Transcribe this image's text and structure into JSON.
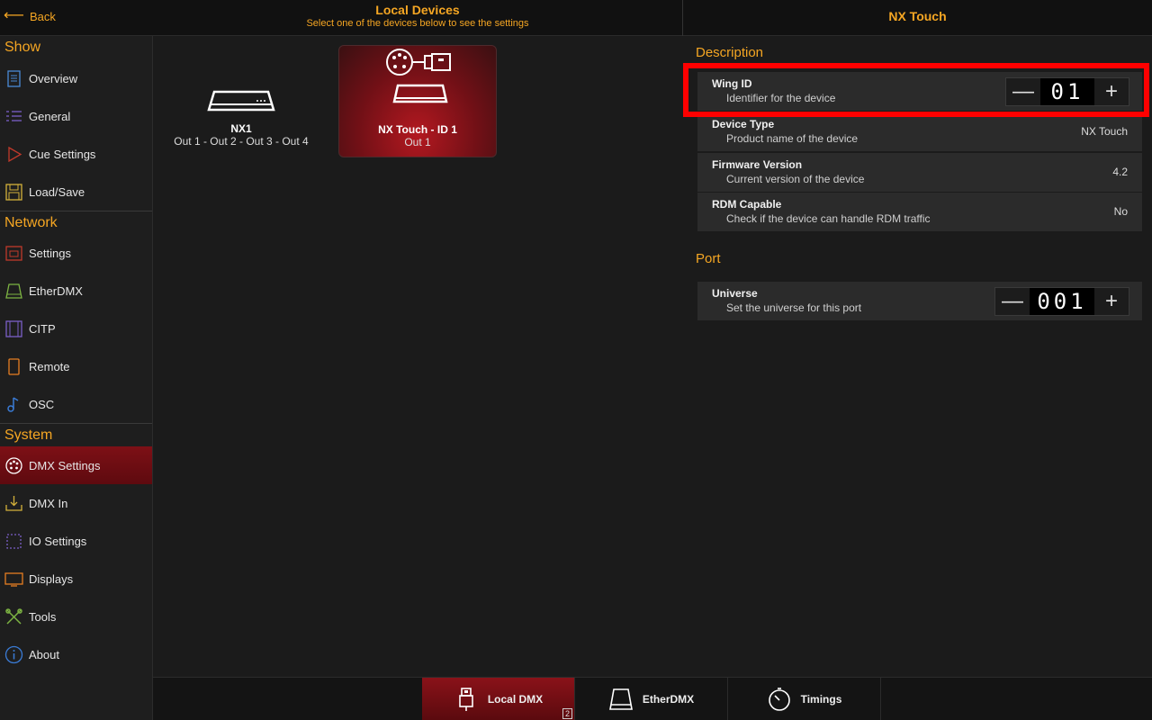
{
  "topbar": {
    "back_label": "Back",
    "title": "Local Devices",
    "subtitle": "Select one of the devices below to see the settings",
    "right_title": "NX Touch"
  },
  "sidebar": {
    "sections": [
      {
        "title": "Show",
        "items": [
          {
            "label": "Overview",
            "icon": "document-icon",
            "color": "#4a8bd6"
          },
          {
            "label": "General",
            "icon": "list-icon",
            "color": "#7b5fc7"
          },
          {
            "label": "Cue Settings",
            "icon": "play-icon",
            "color": "#c0392b"
          },
          {
            "label": "Load/Save",
            "icon": "floppy-icon",
            "color": "#d4b13b"
          }
        ]
      },
      {
        "title": "Network",
        "items": [
          {
            "label": "Settings",
            "icon": "ethernet-icon",
            "color": "#c0392b"
          },
          {
            "label": "EtherDMX",
            "icon": "etherdmx-icon",
            "color": "#7cb342"
          },
          {
            "label": "CITP",
            "icon": "film-icon",
            "color": "#7b5fc7"
          },
          {
            "label": "Remote",
            "icon": "phone-icon",
            "color": "#e67e22"
          },
          {
            "label": "OSC",
            "icon": "music-note-icon",
            "color": "#3a7bd5"
          }
        ]
      },
      {
        "title": "System",
        "items": [
          {
            "label": "DMX Settings",
            "icon": "dmx-connector-icon",
            "color": "#ffffff",
            "active": true
          },
          {
            "label": "DMX In",
            "icon": "dmx-in-icon",
            "color": "#d4b13b"
          },
          {
            "label": "IO Settings",
            "icon": "io-chip-icon",
            "color": "#7b5fc7"
          },
          {
            "label": "Displays",
            "icon": "monitor-icon",
            "color": "#e67e22"
          },
          {
            "label": "Tools",
            "icon": "tools-icon",
            "color": "#7cb342"
          },
          {
            "label": "About",
            "icon": "info-icon",
            "color": "#3a7bd5"
          }
        ]
      }
    ]
  },
  "devices": [
    {
      "name": "NX1",
      "sub": "Out 1 - Out 2 - Out 3 - Out 4",
      "selected": false
    },
    {
      "name": "NX Touch - ID 1",
      "sub": "Out 1",
      "selected": true
    }
  ],
  "settings": {
    "description_title": "Description",
    "rows": [
      {
        "label": "Wing ID",
        "desc": "Identifier for the device",
        "stepper": "01"
      },
      {
        "label": "Device Type",
        "desc": "Product name of the device",
        "value": "NX Touch"
      },
      {
        "label": "Firmware Version",
        "desc": "Current version of the device",
        "value": "4.2"
      },
      {
        "label": "RDM Capable",
        "desc": "Check if the device can handle RDM traffic",
        "value": "No"
      }
    ],
    "port_title": "Port",
    "port_rows": [
      {
        "label": "Universe",
        "desc": "Set the universe for this port",
        "stepper": "001"
      }
    ],
    "minus": "—",
    "plus": "+"
  },
  "bottom_tabs": [
    {
      "label": "Local DMX",
      "icon": "usb-icon",
      "active": true,
      "badge": "2"
    },
    {
      "label": "EtherDMX",
      "icon": "etherdmx-box-icon",
      "active": false
    },
    {
      "label": "Timings",
      "icon": "stopwatch-icon",
      "active": false
    }
  ],
  "colors": {
    "accent": "#f5a623",
    "active_red": "#7d1016",
    "highlight": "#ff0000"
  }
}
